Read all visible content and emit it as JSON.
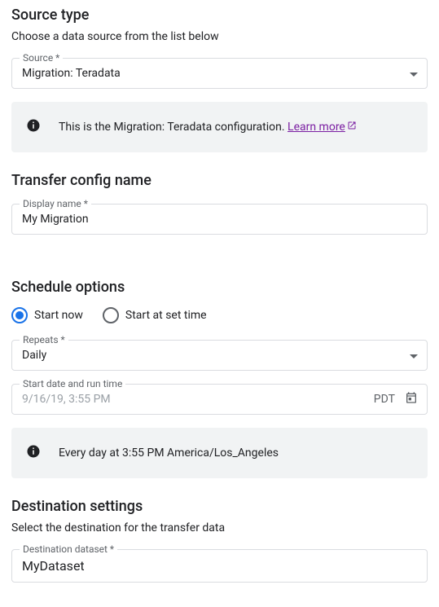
{
  "sourceType": {
    "title": "Source type",
    "subtitle": "Choose a data source from the list below",
    "sourceLabel": "Source *",
    "sourceValue": "Migration: Teradata",
    "infoText": "This is the Migration: Teradata configuration. ",
    "learnMoreLabel": "Learn more"
  },
  "transferConfig": {
    "title": "Transfer config name",
    "displayNameLabel": "Display name *",
    "displayNameValue": "My Migration"
  },
  "schedule": {
    "title": "Schedule options",
    "startNowLabel": "Start now",
    "startAtSetTimeLabel": "Start at set time",
    "selectedOption": "startNow",
    "repeatsLabel": "Repeats *",
    "repeatsValue": "Daily",
    "startDateLabel": "Start date and run time",
    "startDateValue": "9/16/19, 3:55 PM",
    "timezone": "PDT",
    "infoText": "Every day at 3:55 PM America/Los_Angeles"
  },
  "destination": {
    "title": "Destination settings",
    "subtitle": "Select the destination for the transfer data",
    "datasetLabel": "Destination dataset *",
    "datasetValue": "MyDataset"
  }
}
